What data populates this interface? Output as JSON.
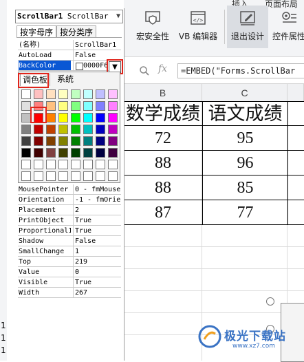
{
  "ribbon": {
    "tab_left": "插入",
    "tab_right": "页面布局",
    "buttons": [
      {
        "label": "宏安全性",
        "icon": "shield-icon"
      },
      {
        "label": "VB 编辑器",
        "icon": "code-window-icon"
      },
      {
        "label": "退出设计",
        "icon": "design-mode-icon"
      },
      {
        "label": "控件属性",
        "icon": "gear-list-icon"
      }
    ]
  },
  "formula_bar": {
    "fx": "fx",
    "formula": "=EMBED(\"Forms.ScrollBar"
  },
  "sheet": {
    "columns": [
      "B",
      "C"
    ],
    "headers": [
      "数学成绩",
      "语文成绩"
    ],
    "rows": [
      [
        "72",
        "95"
      ],
      [
        "88",
        "96"
      ],
      [
        "88",
        "85"
      ],
      [
        "87",
        "77"
      ]
    ],
    "left_fragments": [
      "1",
      "1",
      "1"
    ]
  },
  "properties_panel": {
    "object": {
      "name": "ScrollBar1",
      "type": "ScrollBar"
    },
    "tabs": [
      "按字母序",
      "按分类序"
    ],
    "top_rows": [
      {
        "name": "(名称)",
        "value": "ScrollBar1"
      },
      {
        "name": "AutoLoad",
        "value": "False"
      },
      {
        "name": "BackColor",
        "value": "0000F6"
      }
    ],
    "rows": [
      {
        "name": "MousePointer",
        "value": "0 - fmMouseP"
      },
      {
        "name": "Orientation",
        "value": "-1 - fmOrien"
      },
      {
        "name": "Placement",
        "value": "2"
      },
      {
        "name": "PrintObject",
        "value": "True"
      },
      {
        "name": "Proportional1",
        "value": "True"
      },
      {
        "name": "Shadow",
        "value": "False"
      },
      {
        "name": "SmallChange",
        "value": "1"
      },
      {
        "name": "Top",
        "value": "219"
      },
      {
        "name": "Value",
        "value": "0"
      },
      {
        "name": "Visible",
        "value": "True"
      },
      {
        "name": "Width",
        "value": "267"
      }
    ]
  },
  "color_picker": {
    "tabs": [
      "调色板",
      "系统"
    ],
    "palette": [
      [
        "#ffffff",
        "#ffc0c0",
        "#ffe0c0",
        "#ffffc0",
        "#c0ffc0",
        "#c0ffff",
        "#c0c0ff",
        "#ffc0ff"
      ],
      [
        "#e0e0e0",
        "#ff8080",
        "#ffc080",
        "#ffff80",
        "#80ff80",
        "#80ffff",
        "#8080ff",
        "#ff80ff"
      ],
      [
        "#c0c0c0",
        "#ff0000",
        "#ff8000",
        "#ffff00",
        "#00ff00",
        "#00ffff",
        "#0000ff",
        "#ff00ff"
      ],
      [
        "#808080",
        "#c00000",
        "#c04000",
        "#c0c000",
        "#00c000",
        "#00c0c0",
        "#0000c0",
        "#c000c0"
      ],
      [
        "#404040",
        "#800000",
        "#804000",
        "#808000",
        "#008000",
        "#008080",
        "#000080",
        "#800080"
      ],
      [
        "#000000",
        "#400000",
        "#804040",
        "#404000",
        "#004000",
        "#004040",
        "#000040",
        "#400040"
      ],
      [
        "#ffffff",
        "#ffffff",
        "#ffffff",
        "#ffffff",
        "#ffffff",
        "#ffffff",
        "#ffffff",
        "#ffffff"
      ],
      [
        "#ffffff",
        "#ffffff",
        "#ffffff",
        "#ffffff",
        "#ffffff",
        "#ffffff",
        "#ffffff",
        "#ffffff"
      ]
    ]
  },
  "watermark": {
    "text": "极光下载站",
    "url": "www.xz7.com"
  },
  "colors": {
    "highlight": "#0a57d4",
    "annotation_red": "#e0241b",
    "accent": "#3a73c4"
  }
}
